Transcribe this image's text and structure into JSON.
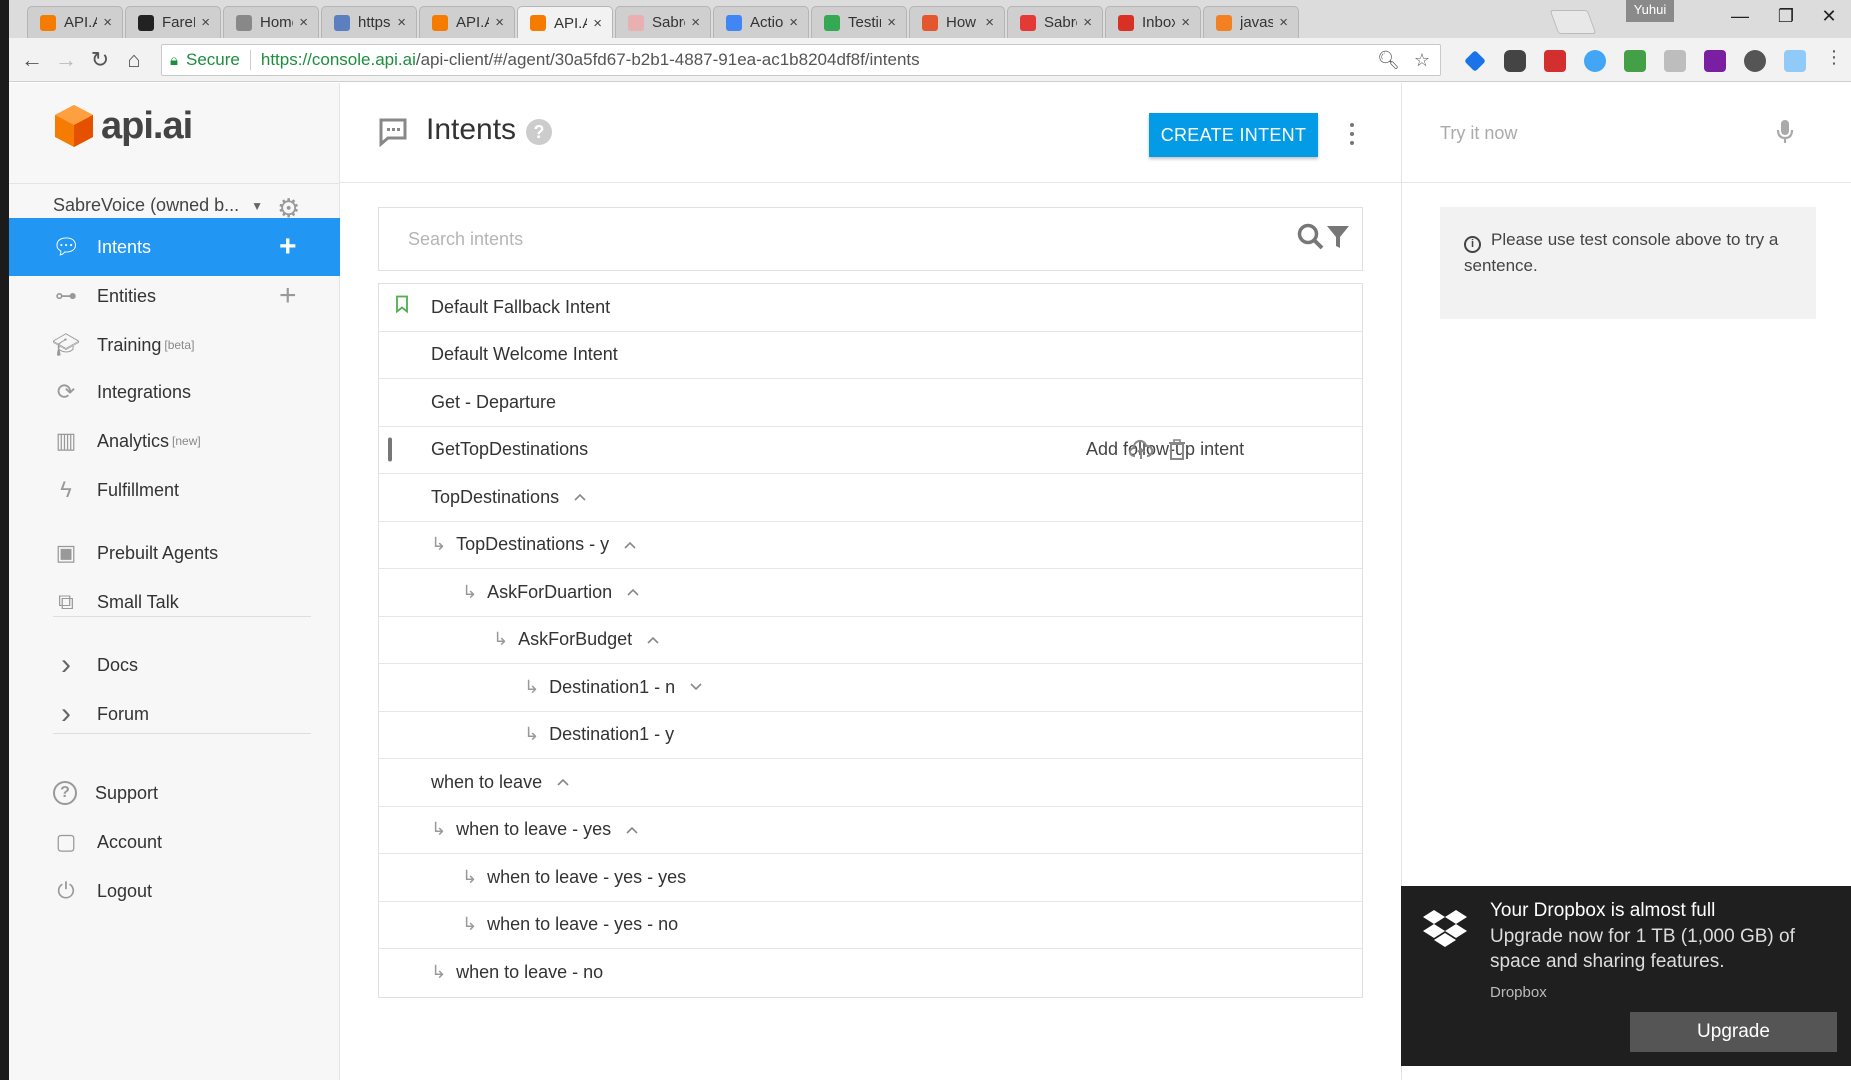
{
  "browser": {
    "tabs": [
      {
        "label": "API.AI",
        "fav_color": "#f57c00"
      },
      {
        "label": "FarePr",
        "fav_color": "#222222"
      },
      {
        "label": "Home",
        "fav_color": "#888888"
      },
      {
        "label": "https:",
        "fav_color": "#5b7fbf"
      },
      {
        "label": "API.AI",
        "fav_color": "#f57c00"
      },
      {
        "label": "API.AI",
        "fav_color": "#f57c00"
      },
      {
        "label": "Sabre",
        "fav_color": "#e8b0b0"
      },
      {
        "label": "Action",
        "fav_color": "#4285f4"
      },
      {
        "label": "Testin",
        "fav_color": "#34a853"
      },
      {
        "label": "How T",
        "fav_color": "#e4572e"
      },
      {
        "label": "Sabre",
        "fav_color": "#e53935"
      },
      {
        "label": "Inbox",
        "fav_color": "#d93025"
      },
      {
        "label": "javasc",
        "fav_color": "#f48024"
      }
    ],
    "close_glyph": "×",
    "user_badge": "Yuhui",
    "secure_label": "Secure",
    "url_host": "https://console.api.ai",
    "url_path": "/api-client/#/agent/30a5fd67-b2b1-4887-91ea-ac1b8204df8f/intents"
  },
  "sidebar": {
    "logo_text": "api.ai",
    "agent_name": "SabreVoice (owned b...",
    "nav": [
      {
        "label": "Intents",
        "icon": "chat-icon",
        "active": true,
        "plus": true
      },
      {
        "label": "Entities",
        "icon": "hierarchy-icon",
        "plus": true
      },
      {
        "label": "Training",
        "sup": "[beta]",
        "icon": "graduation-cap-icon"
      },
      {
        "label": "Integrations",
        "icon": "sync-icon"
      },
      {
        "label": "Analytics",
        "sup": "[new]",
        "icon": "bar-chart-icon"
      },
      {
        "label": "Fulfillment",
        "icon": "bolt-icon"
      },
      {
        "label": "Prebuilt Agents",
        "icon": "agent-icon"
      },
      {
        "label": "Small Talk",
        "icon": "chat-stack-icon"
      },
      {
        "label": "Docs",
        "icon": "chevron-right-icon"
      },
      {
        "label": "Forum",
        "icon": "chevron-right-icon"
      },
      {
        "label": "Support",
        "icon": "help-circle-icon"
      },
      {
        "label": "Account",
        "icon": "account-icon"
      },
      {
        "label": "Logout",
        "icon": "power-icon"
      }
    ]
  },
  "main": {
    "title": "Intents",
    "create_label": "CREATE INTENT",
    "search_placeholder": "Search intents",
    "followup_label": "Add follow-up intent",
    "intents": [
      {
        "name": "Default Fallback Intent",
        "level": 0,
        "marker": "bookmark"
      },
      {
        "name": "Default Welcome Intent",
        "level": 0,
        "marker": "dot"
      },
      {
        "name": "Get - Departure",
        "level": 0,
        "marker": "dot"
      },
      {
        "name": "GetTopDestinations",
        "level": 0,
        "marker": "checkbox",
        "hovered": true
      },
      {
        "name": "TopDestinations",
        "level": 0,
        "marker": "dot",
        "chevron": "up"
      },
      {
        "name": "TopDestinations - y",
        "level": 1,
        "marker": "dot",
        "chevron": "up"
      },
      {
        "name": "AskForDuartion",
        "level": 2,
        "marker": "dot",
        "chevron": "up"
      },
      {
        "name": "AskForBudget",
        "level": 3,
        "marker": "dot",
        "chevron": "up"
      },
      {
        "name": "Destination1 - n",
        "level": 4,
        "marker": "dot",
        "chevron": "down"
      },
      {
        "name": "Destination1 - y",
        "level": 4,
        "marker": "dot"
      },
      {
        "name": "when to leave",
        "level": 0,
        "marker": "dot",
        "chevron": "up"
      },
      {
        "name": "when to leave - yes",
        "level": 1,
        "marker": "dot",
        "chevron": "up"
      },
      {
        "name": "when to leave - yes - yes",
        "level": 2,
        "marker": "dot"
      },
      {
        "name": "when to leave - yes - no",
        "level": 2,
        "marker": "dot"
      },
      {
        "name": "when to leave - no",
        "level": 1,
        "marker": "dot"
      }
    ]
  },
  "right": {
    "try_placeholder": "Try it now",
    "info_text": "Please use test console above to try a sentence."
  },
  "toast": {
    "title": "Your Dropbox is almost full",
    "message": "Upgrade now for 1 TB (1,000 GB) of space and sharing features.",
    "source": "Dropbox",
    "button": "Upgrade"
  },
  "colors": {
    "accent": "#2196f3",
    "button": "#039be5",
    "dot": "#5a9ee6",
    "logo": "#f57c00"
  }
}
